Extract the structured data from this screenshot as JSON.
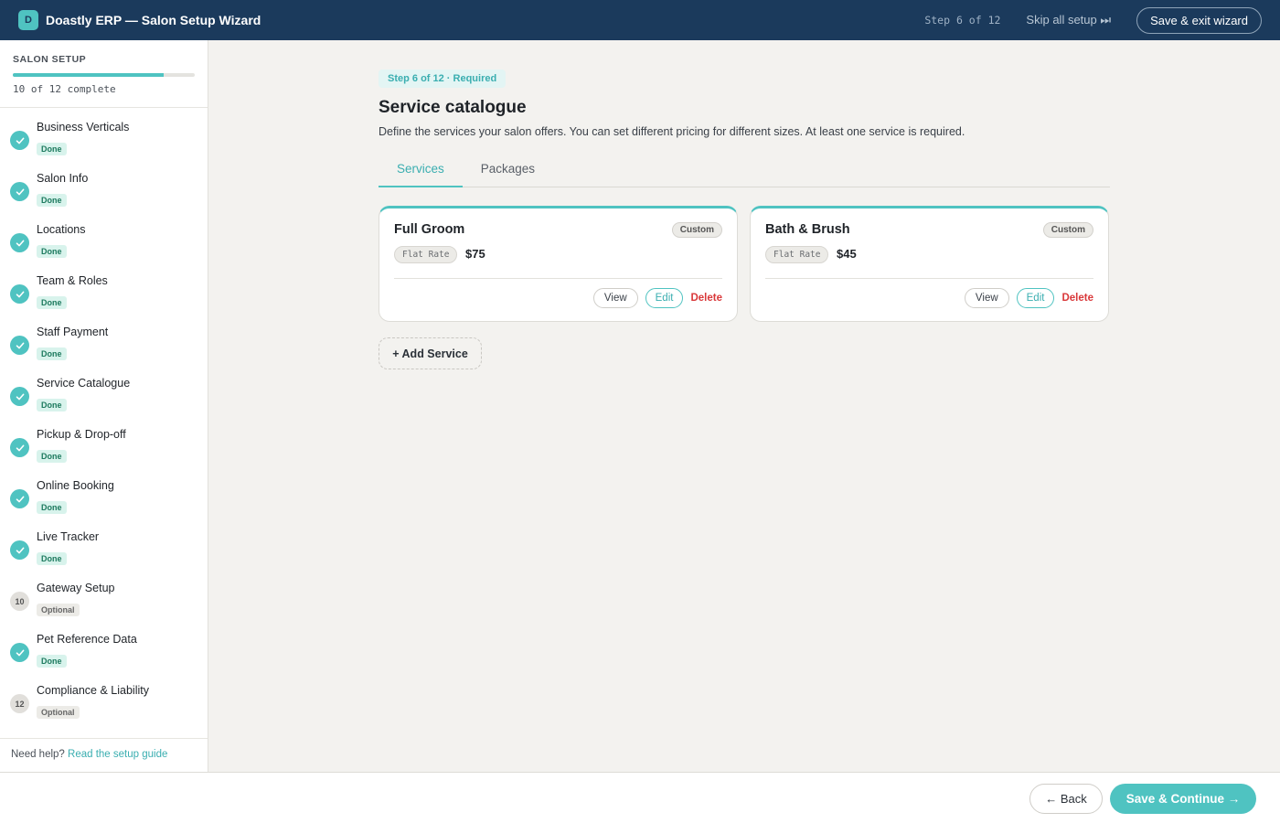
{
  "header": {
    "logo_letter": "D",
    "app_title": "Doastly ERP — Salon Setup Wizard",
    "step_counter": "Step 6 of 12",
    "skip_label": "Skip all setup ⏭",
    "exit_label": "Save & exit wizard"
  },
  "sidebar": {
    "heading": "SALON SETUP",
    "progress_fraction": 0.83,
    "progress_text": "10 of 12 complete",
    "steps": [
      {
        "label": "Business Verticals",
        "status": "Done",
        "marker": "check"
      },
      {
        "label": "Salon Info",
        "status": "Done",
        "marker": "check"
      },
      {
        "label": "Locations",
        "status": "Done",
        "marker": "check"
      },
      {
        "label": "Team & Roles",
        "status": "Done",
        "marker": "check"
      },
      {
        "label": "Staff Payment",
        "status": "Done",
        "marker": "check"
      },
      {
        "label": "Service Catalogue",
        "status": "Done",
        "marker": "check"
      },
      {
        "label": "Pickup & Drop-off",
        "status": "Done",
        "marker": "check"
      },
      {
        "label": "Online Booking",
        "status": "Done",
        "marker": "check"
      },
      {
        "label": "Live Tracker",
        "status": "Done",
        "marker": "check"
      },
      {
        "label": "Gateway Setup",
        "status": "Optional",
        "marker": "10"
      },
      {
        "label": "Pet Reference Data",
        "status": "Done",
        "marker": "check"
      },
      {
        "label": "Compliance & Liability",
        "status": "Optional",
        "marker": "12"
      }
    ],
    "help_prefix": "Need help?",
    "help_link": "Read the setup guide"
  },
  "main": {
    "step_pill": "Step 6 of 12 · Required",
    "title": "Service catalogue",
    "description": "Define the services your salon offers. You can set different pricing for different sizes. At least one service is required.",
    "tabs": [
      {
        "label": "Services",
        "active": true
      },
      {
        "label": "Packages",
        "active": false
      }
    ],
    "services": [
      {
        "name": "Full Groom",
        "tag": "Custom",
        "rate_type": "Flat Rate",
        "price": "$75",
        "view": "View",
        "edit": "Edit",
        "delete": "Delete"
      },
      {
        "name": "Bath & Brush",
        "tag": "Custom",
        "rate_type": "Flat Rate",
        "price": "$45",
        "view": "View",
        "edit": "Edit",
        "delete": "Delete"
      }
    ],
    "add_service_label": "+ Add Service"
  },
  "footer": {
    "back_label": "← Back",
    "continue_label": "Save & Continue →"
  },
  "colors": {
    "header_bg": "#1b3a5c",
    "accent": "#4fc3c1",
    "danger": "#d9383a"
  }
}
